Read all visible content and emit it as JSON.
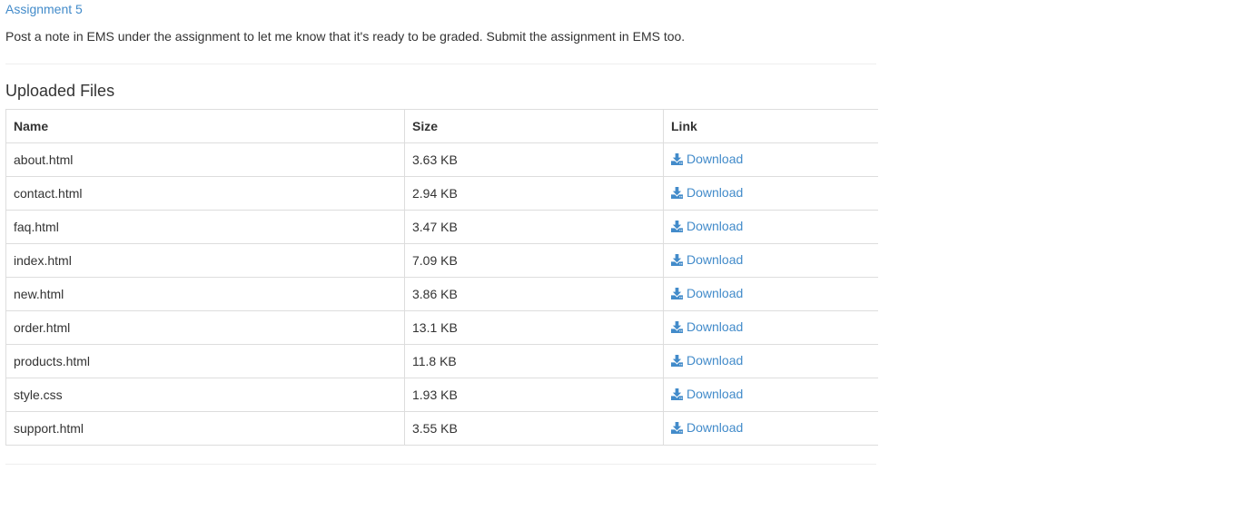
{
  "assignment": {
    "title": "Assignment 5",
    "note": "Post a note in EMS under the assignment to let me know that it's ready to be graded. Submit the assignment in EMS too."
  },
  "uploaded_files": {
    "heading": "Uploaded Files",
    "columns": [
      "Name",
      "Size",
      "Link"
    ],
    "rows": [
      {
        "name": "about.html",
        "size": "3.63 KB",
        "link_label": "Download"
      },
      {
        "name": "contact.html",
        "size": "2.94 KB",
        "link_label": "Download"
      },
      {
        "name": "faq.html",
        "size": "3.47 KB",
        "link_label": "Download"
      },
      {
        "name": "index.html",
        "size": "7.09 KB",
        "link_label": "Download"
      },
      {
        "name": "new.html",
        "size": "3.86 KB",
        "link_label": "Download"
      },
      {
        "name": "order.html",
        "size": "13.1 KB",
        "link_label": "Download"
      },
      {
        "name": "products.html",
        "size": "11.8 KB",
        "link_label": "Download"
      },
      {
        "name": "style.css",
        "size": "1.93 KB",
        "link_label": "Download"
      },
      {
        "name": "support.html",
        "size": "3.55 KB",
        "link_label": "Download"
      }
    ],
    "link_icon": "download-icon"
  },
  "colors": {
    "link": "#428bca",
    "text": "#333333",
    "border": "#dddddd",
    "divider": "#eeeeee"
  }
}
